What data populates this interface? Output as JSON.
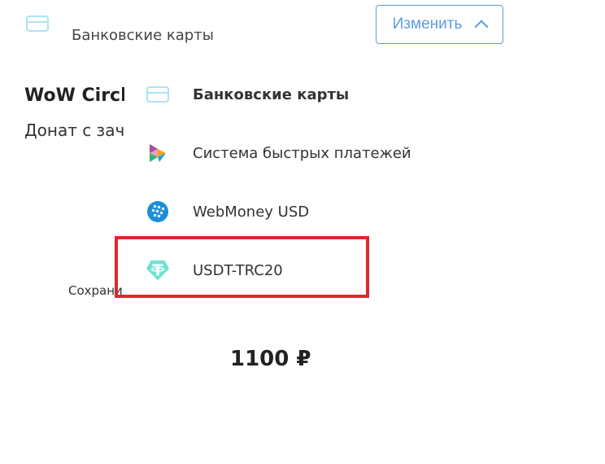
{
  "header": {
    "current_method_label": "Банковские карты",
    "change_button_label": "Изменить"
  },
  "product": {
    "title": "WoW Circle",
    "subtitle": "Донат с зач",
    "save_text": "Сохрани",
    "price": "1100 ₽"
  },
  "dropdown": {
    "items": [
      {
        "label": "Банковские карты",
        "icon": "bank-card-icon",
        "selected": true
      },
      {
        "label": "Система быстрых платежей",
        "icon": "sbp-icon"
      },
      {
        "label": "WebMoney USD",
        "icon": "webmoney-icon"
      },
      {
        "label": "USDT-TRC20",
        "icon": "tether-icon",
        "highlighted": true
      }
    ]
  },
  "colors": {
    "accent": "#5b9be0",
    "card_icon": "#aee2f2",
    "highlight": "#e0262f",
    "webmoney": "#1a8fd8",
    "tether": "#6fe3d3"
  }
}
